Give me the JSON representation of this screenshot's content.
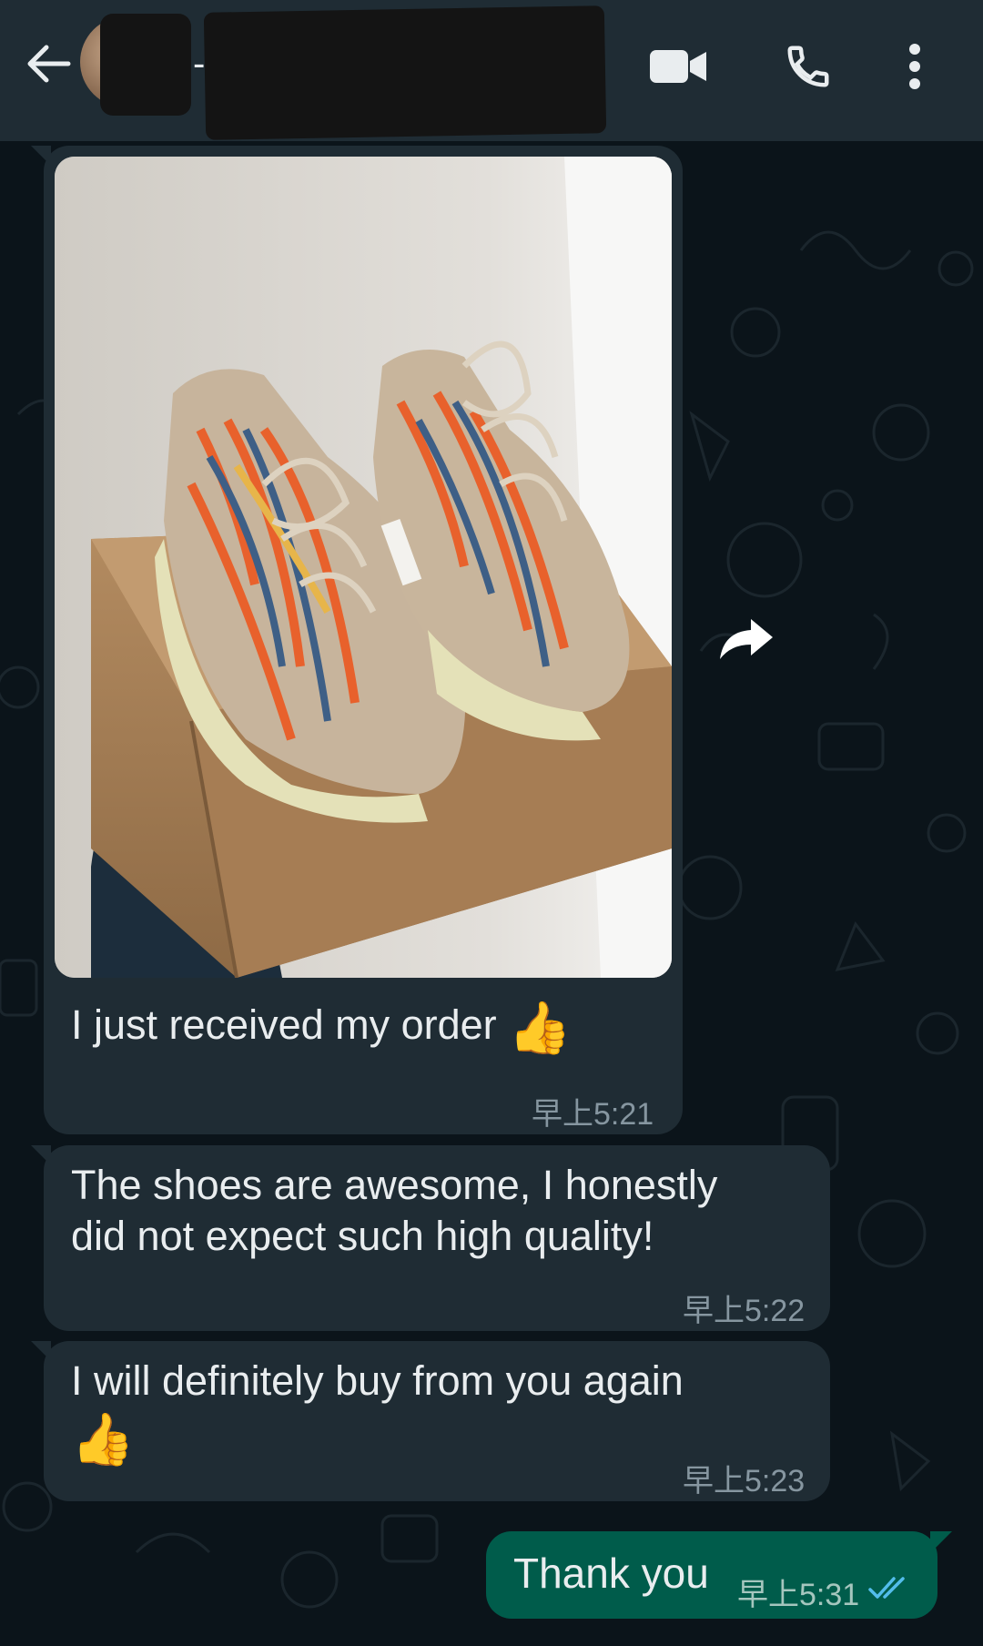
{
  "header": {
    "contact_name": "-"
  },
  "icons": {
    "back": "arrow-left",
    "video": "video-camera",
    "call": "phone",
    "menu": "three-dots-vertical",
    "forward": "share-forward"
  },
  "messages": [
    {
      "text": "I just received my order",
      "emoji": "👍",
      "time": "早上5:21"
    },
    {
      "line1": "The shoes are awesome, I honestly",
      "line2": "did not expect such high quality!",
      "time": "早上5:22"
    },
    {
      "text": "I will definitely buy from you again",
      "emoji": "👍",
      "time": "早上5:23"
    },
    {
      "text": "Thank you",
      "time": "早上5:31",
      "status": "read"
    }
  ],
  "colors": {
    "header_bg": "#1f2c34",
    "chat_bg": "#0b141a",
    "incoming_bubble": "#1f2c34",
    "outgoing_bubble": "#005c4b",
    "read_ticks": "#53bdeb"
  }
}
